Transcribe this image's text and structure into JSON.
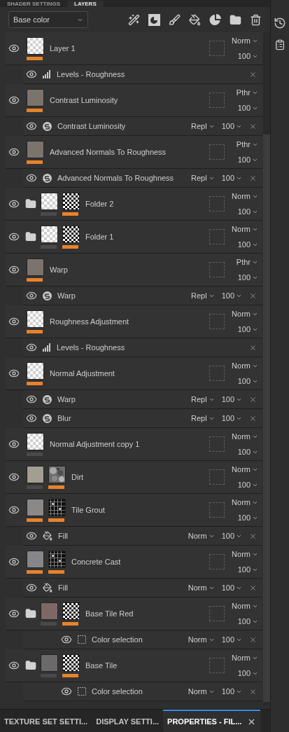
{
  "top_tabs": [
    {
      "label": "SHADER SETTINGS",
      "selected": false
    },
    {
      "label": "LAYERS",
      "selected": true
    }
  ],
  "channel_select": {
    "value": "Base color"
  },
  "layers": [
    {
      "kind": "layer",
      "name": "Layer 1",
      "thumb": {
        "kind": "checker"
      },
      "thumb_active": true,
      "blend": "Norm",
      "opacity": "100",
      "effects": [
        {
          "kind": "levels",
          "name": "Levels - Roughness"
        }
      ]
    },
    {
      "kind": "layer",
      "name": "Contrast Luminosity",
      "thumb": {
        "kind": "color",
        "color": "#7b746c"
      },
      "thumb_active": true,
      "blend": "Pthr",
      "opacity": "100",
      "effects": [
        {
          "kind": "filter",
          "name": "Contrast Luminosity",
          "blend": "Repl",
          "opacity": "100"
        }
      ]
    },
    {
      "kind": "layer",
      "name": "Advanced Normals To Roughness",
      "thumb": {
        "kind": "color",
        "color": "#7b746c"
      },
      "thumb_active": true,
      "blend": "Pthr",
      "opacity": "100",
      "effects": [
        {
          "kind": "filter",
          "name": "Advanced Normals To Roughness",
          "blend": "Repl",
          "opacity": "100"
        }
      ]
    },
    {
      "kind": "folder",
      "name": "Folder 2",
      "thumb": {
        "kind": "checker"
      },
      "thumb_active": false,
      "mask": {
        "kind": "checker-large"
      },
      "mask_active": true,
      "blend": "Norm",
      "opacity": "100"
    },
    {
      "kind": "folder",
      "name": "Folder 1",
      "thumb": {
        "kind": "checker"
      },
      "thumb_active": false,
      "mask": {
        "kind": "checker-large"
      },
      "mask_active": true,
      "blend": "Norm",
      "opacity": "100"
    },
    {
      "kind": "layer",
      "name": "Warp",
      "thumb": {
        "kind": "color",
        "color": "#7b746c"
      },
      "thumb_active": true,
      "blend": "Pthr",
      "opacity": "100",
      "effects": [
        {
          "kind": "filter",
          "name": "Warp",
          "blend": "Repl",
          "opacity": "100"
        }
      ]
    },
    {
      "kind": "layer",
      "name": "Roughness Adjustment",
      "thumb": {
        "kind": "checker"
      },
      "thumb_active": true,
      "blend": "Norm",
      "opacity": "100",
      "effects": [
        {
          "kind": "levels",
          "name": "Levels - Roughness"
        }
      ]
    },
    {
      "kind": "layer",
      "name": "Normal Adjustment",
      "thumb": {
        "kind": "checker"
      },
      "thumb_active": true,
      "blend": "Norm",
      "opacity": "100",
      "effects": [
        {
          "kind": "filter",
          "name": "Warp",
          "blend": "Repl",
          "opacity": "100"
        },
        {
          "kind": "filter",
          "name": "Blur",
          "blend": "Repl",
          "opacity": "100"
        }
      ]
    },
    {
      "kind": "layer",
      "name": "Normal Adjustment copy 1",
      "thumb": {
        "kind": "checker"
      },
      "thumb_active": false,
      "blend": "Norm",
      "opacity": "100"
    },
    {
      "kind": "fill",
      "name": "Dirt",
      "thumb": {
        "kind": "color",
        "color": "#a29e91"
      },
      "thumb_active": false,
      "mask": {
        "kind": "noise"
      },
      "mask_active": true,
      "blend": "Norm",
      "opacity": "100"
    },
    {
      "kind": "fill",
      "name": "Tile Grout",
      "thumb": {
        "kind": "color",
        "color": "#8b8987"
      },
      "thumb_active": true,
      "mask": {
        "kind": "grid"
      },
      "mask_active": true,
      "blend": "Norm",
      "opacity": "100",
      "effects": [
        {
          "kind": "fill",
          "name": "Fill",
          "blend": "Norm",
          "opacity": "100"
        }
      ]
    },
    {
      "kind": "fill",
      "name": "Concrete Cast",
      "thumb": {
        "kind": "color",
        "color": "#86868a"
      },
      "thumb_active": true,
      "mask": {
        "kind": "grid"
      },
      "mask_active": true,
      "blend": "Norm",
      "opacity": "100",
      "effects": [
        {
          "kind": "fill",
          "name": "Fill",
          "blend": "Norm",
          "opacity": "100"
        }
      ]
    },
    {
      "kind": "folder",
      "name": "Base Tile Red",
      "thumb": {
        "kind": "color",
        "color": "#7d6767"
      },
      "thumb_active": false,
      "mask": {
        "kind": "checker-large"
      },
      "mask_active": true,
      "blend": "Norm",
      "opacity": "100",
      "effects": [
        {
          "kind": "selection",
          "name": "Color selection",
          "blend": "Norm",
          "opacity": "100"
        }
      ]
    },
    {
      "kind": "folder",
      "name": "Base Tile",
      "thumb": {
        "kind": "color",
        "color": "#6b6969"
      },
      "thumb_active": false,
      "mask": {
        "kind": "checker-large"
      },
      "mask_active": true,
      "blend": "Norm",
      "opacity": "100",
      "effects": [
        {
          "kind": "selection",
          "name": "Color selection",
          "blend": "Norm",
          "opacity": "100"
        }
      ]
    }
  ],
  "bottom_tabs": [
    {
      "label": "TEXTURE SET SETTI...",
      "selected": false
    },
    {
      "label": "DISPLAY SETTI...",
      "selected": false
    },
    {
      "label": "PROPERTIES - FIL...",
      "selected": true
    }
  ]
}
